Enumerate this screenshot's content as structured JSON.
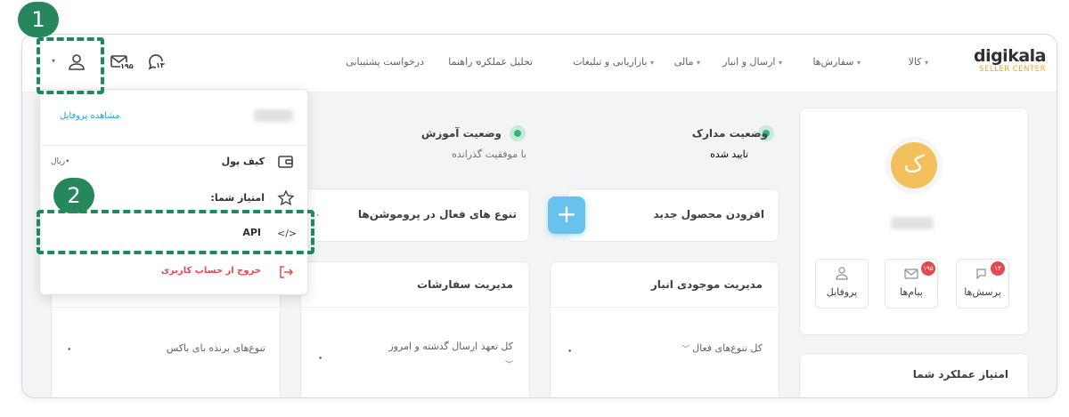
{
  "brand": {
    "name": "digikala",
    "sub": "SELLER CENTER"
  },
  "nav": [
    "کالا",
    "سفارش‌ها",
    "ارسال و انبار",
    "مالی",
    "بازاریابی و تبلیغات",
    "تحلیل عملکرد",
    "راهنما",
    "درخواست پشتیبانی"
  ],
  "header_icons": {
    "notif_count": "۱۳",
    "mail_count": "۱۹۵"
  },
  "steps": {
    "one": "1",
    "two": "2"
  },
  "profile_menu": {
    "view_profile": "مشاهده پروفایل",
    "wallet_label": "کیف پول",
    "wallet_value": "•ریال",
    "score_label": "امتیاز شما:",
    "api_label": "API",
    "logout_label": "خروج از حساب کاربری"
  },
  "seller_card": {
    "avatar_letter": "ک",
    "tiles": [
      {
        "label": "پرسش‌ها",
        "badge": "۱۳"
      },
      {
        "label": "پیام‌ها",
        "badge": "۱۹۵"
      },
      {
        "label": "پروفایل",
        "badge": ""
      }
    ]
  },
  "status": {
    "docs_title": "وضعیت مدارک",
    "docs_value": "تایید شده",
    "training_title": "وضعیت آموزش",
    "training_value": "با موفقیت گذرانده"
  },
  "actions": {
    "add_product": "افزودن محصول جدید",
    "promo_title": "تنوع های فعال در پروموشن‌ها",
    "promo_count": "۰"
  },
  "panels": {
    "inventory_title": "مدیریت موجودی انبار",
    "inventory_filter": "کل تنوع‌های فعال",
    "inventory_value": "۰",
    "orders_title": "مدیریت سفارشات",
    "orders_filter": "کل تعهد ارسال گذشته و امروز",
    "orders_value": "۰",
    "buybox_label": "تنوع‌های برنده بای باکس",
    "buybox_value": "۰",
    "performance_title": "امتیاز عملکرد شما"
  },
  "colors": {
    "accent_green": "#1c8a5b",
    "digikala_orange": "#f4a623",
    "add_button": "#67c3ee",
    "badge_red": "#e14a50",
    "link_blue": "#21a4d0",
    "logout_red": "#e5484d"
  }
}
